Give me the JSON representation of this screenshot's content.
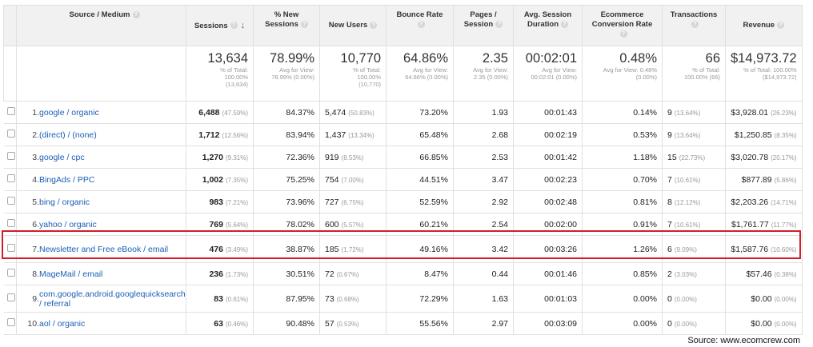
{
  "header": {
    "source_medium": "Source / Medium",
    "sessions": "Sessions",
    "new_sessions": "% New Sessions",
    "new_users": "New Users",
    "bounce_rate": "Bounce Rate",
    "pages_session_1": "Pages /",
    "pages_session_2": "Session",
    "avg_duration_1": "Avg. Session",
    "avg_duration_2": "Duration",
    "ecom_1": "Ecommerce",
    "ecom_2": "Conversion Rate",
    "transactions": "Transactions",
    "revenue": "Revenue",
    "help_glyph": "?",
    "sort_glyph": "↓"
  },
  "totals": {
    "sessions": {
      "value": "13,634",
      "s1": "% of Total:",
      "s2": "100.00%",
      "s3": "(13,634)"
    },
    "new_sessions": {
      "value": "78.99%",
      "s1": "Avg for View:",
      "s2": "78.99% (0.00%)",
      "s3": ""
    },
    "new_users": {
      "value": "10,770",
      "s1": "% of Total:",
      "s2": "100.00%",
      "s3": "(10,770)"
    },
    "bounce_rate": {
      "value": "64.86%",
      "s1": "Avg for View:",
      "s2": "64.86% (0.00%)",
      "s3": ""
    },
    "pages_session": {
      "value": "2.35",
      "s1": "Avg for View:",
      "s2": "2.35 (0.00%)",
      "s3": ""
    },
    "avg_duration": {
      "value": "00:02:01",
      "s1": "Avg for View:",
      "s2": "00:02:01 (0.00%)",
      "s3": ""
    },
    "ecom_rate": {
      "value": "0.48%",
      "s1": "Avg for View: 0.48%",
      "s2": "(0.00%)",
      "s3": ""
    },
    "transactions": {
      "value": "66",
      "s1": "% of Total:",
      "s2": "100.00% (66)",
      "s3": ""
    },
    "revenue": {
      "value": "$14,973.72",
      "s1": "% of Total: 100.00%",
      "s2": "($14,973.72)",
      "s3": ""
    }
  },
  "rows": [
    {
      "idx": "1.",
      "source": "google / organic",
      "sessions": "6,488",
      "sessions_pct": "(47.59%)",
      "new_sessions": "84.37%",
      "new_users": "5,474",
      "new_users_pct": "(50.83%)",
      "bounce": "73.20%",
      "pages": "1.93",
      "duration": "00:01:43",
      "ecom": "0.14%",
      "trans": "9",
      "trans_pct": "(13.64%)",
      "revenue": "$3,928.01",
      "revenue_pct": "(26.23%)"
    },
    {
      "idx": "2.",
      "source": "(direct) / (none)",
      "sessions": "1,712",
      "sessions_pct": "(12.56%)",
      "new_sessions": "83.94%",
      "new_users": "1,437",
      "new_users_pct": "(13.34%)",
      "bounce": "65.48%",
      "pages": "2.68",
      "duration": "00:02:19",
      "ecom": "0.53%",
      "trans": "9",
      "trans_pct": "(13.64%)",
      "revenue": "$1,250.85",
      "revenue_pct": "(8.35%)"
    },
    {
      "idx": "3.",
      "source": "google / cpc",
      "sessions": "1,270",
      "sessions_pct": "(9.31%)",
      "new_sessions": "72.36%",
      "new_users": "919",
      "new_users_pct": "(8.53%)",
      "bounce": "66.85%",
      "pages": "2.53",
      "duration": "00:01:42",
      "ecom": "1.18%",
      "trans": "15",
      "trans_pct": "(22.73%)",
      "revenue": "$3,020.78",
      "revenue_pct": "(20.17%)"
    },
    {
      "idx": "4.",
      "source": "BingAds / PPC",
      "sessions": "1,002",
      "sessions_pct": "(7.35%)",
      "new_sessions": "75.25%",
      "new_users": "754",
      "new_users_pct": "(7.00%)",
      "bounce": "44.51%",
      "pages": "3.47",
      "duration": "00:02:23",
      "ecom": "0.70%",
      "trans": "7",
      "trans_pct": "(10.61%)",
      "revenue": "$877.89",
      "revenue_pct": "(5.86%)"
    },
    {
      "idx": "5.",
      "source": "bing / organic",
      "sessions": "983",
      "sessions_pct": "(7.21%)",
      "new_sessions": "73.96%",
      "new_users": "727",
      "new_users_pct": "(6.75%)",
      "bounce": "52.59%",
      "pages": "2.92",
      "duration": "00:02:48",
      "ecom": "0.81%",
      "trans": "8",
      "trans_pct": "(12.12%)",
      "revenue": "$2,203.26",
      "revenue_pct": "(14.71%)"
    },
    {
      "idx": "6.",
      "source": "yahoo / organic",
      "sessions": "769",
      "sessions_pct": "(5.64%)",
      "new_sessions": "78.02%",
      "new_users": "600",
      "new_users_pct": "(5.57%)",
      "bounce": "60.21%",
      "pages": "2.54",
      "duration": "00:02:00",
      "ecom": "0.91%",
      "trans": "7",
      "trans_pct": "(10.61%)",
      "revenue": "$1,761.77",
      "revenue_pct": "(11.77%)"
    },
    {
      "idx": "7.",
      "source": "Newsletter and Free eBook / email",
      "sessions": "476",
      "sessions_pct": "(3.49%)",
      "new_sessions": "38.87%",
      "new_users": "185",
      "new_users_pct": "(1.72%)",
      "bounce": "49.16%",
      "pages": "3.42",
      "duration": "00:03:26",
      "ecom": "1.26%",
      "trans": "6",
      "trans_pct": "(9.09%)",
      "revenue": "$1,587.76",
      "revenue_pct": "(10.60%)"
    },
    {
      "idx": "8.",
      "source": "MageMail / email",
      "sessions": "236",
      "sessions_pct": "(1.73%)",
      "new_sessions": "30.51%",
      "new_users": "72",
      "new_users_pct": "(0.67%)",
      "bounce": "8.47%",
      "pages": "0.44",
      "duration": "00:01:46",
      "ecom": "0.85%",
      "trans": "2",
      "trans_pct": "(3.03%)",
      "revenue": "$57.46",
      "revenue_pct": "(0.38%)"
    },
    {
      "idx": "9.",
      "source": "com.google.android.googlequicksearchbox / referral",
      "sessions": "83",
      "sessions_pct": "(0.61%)",
      "new_sessions": "87.95%",
      "new_users": "73",
      "new_users_pct": "(0.68%)",
      "bounce": "72.29%",
      "pages": "1.63",
      "duration": "00:01:03",
      "ecom": "0.00%",
      "trans": "0",
      "trans_pct": "(0.00%)",
      "revenue": "$0.00",
      "revenue_pct": "(0.00%)"
    },
    {
      "idx": "10.",
      "source": "aol / organic",
      "sessions": "63",
      "sessions_pct": "(0.46%)",
      "new_sessions": "90.48%",
      "new_users": "57",
      "new_users_pct": "(0.53%)",
      "bounce": "55.56%",
      "pages": "2.97",
      "duration": "00:03:09",
      "ecom": "0.00%",
      "trans": "0",
      "trans_pct": "(0.00%)",
      "revenue": "$0.00",
      "revenue_pct": "(0.00%)"
    }
  ],
  "footer": {
    "source_note": "Source: www.ecomcrew.com"
  },
  "colors": {
    "highlight": "#d21e2b",
    "link": "#1a5fb4",
    "header_bg": "#f1f1f1"
  }
}
